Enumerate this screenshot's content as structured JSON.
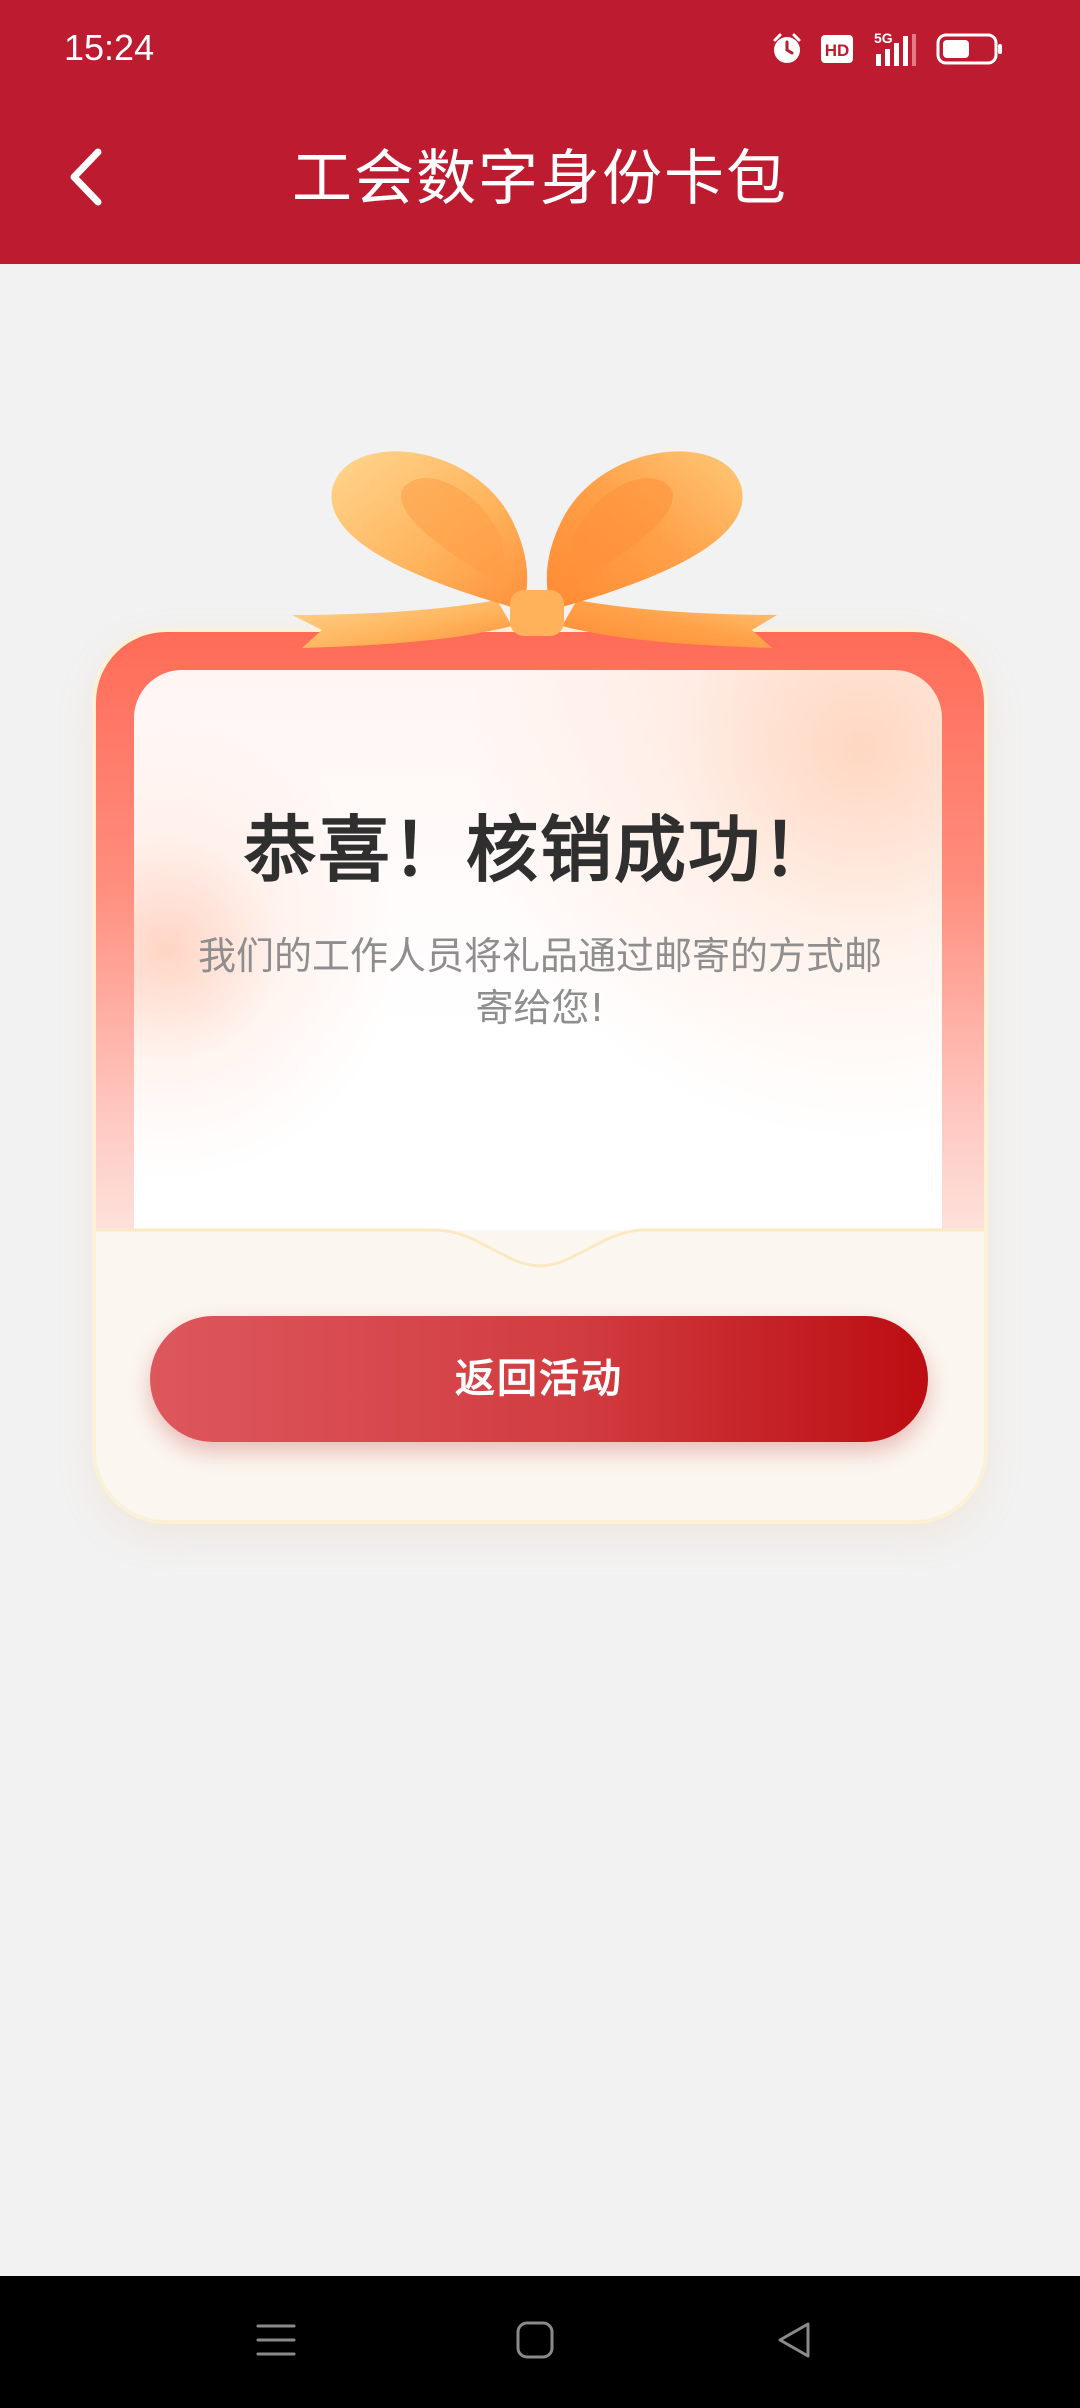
{
  "status_bar": {
    "time": "15:24",
    "hd_label": "HD",
    "network_label": "5G",
    "icons": [
      "alarm-icon",
      "hd-icon",
      "signal-5g-icon",
      "battery-icon"
    ],
    "battery_level": 0.55
  },
  "header": {
    "title": "工会数字身份卡包",
    "back_icon": "chevron-left-icon",
    "background_color": "#bd1b2f"
  },
  "card": {
    "decoration_icon": "gift-bow-icon",
    "headline": "恭喜！核销成功！",
    "message": "我们的工作人员将礼品通过邮寄的方式邮寄给您!",
    "button_label": "返回活动",
    "button_color": "#c8242a"
  },
  "nav_bar": {
    "icons": [
      "menu-icon",
      "home-icon",
      "back-triangle-icon"
    ]
  }
}
